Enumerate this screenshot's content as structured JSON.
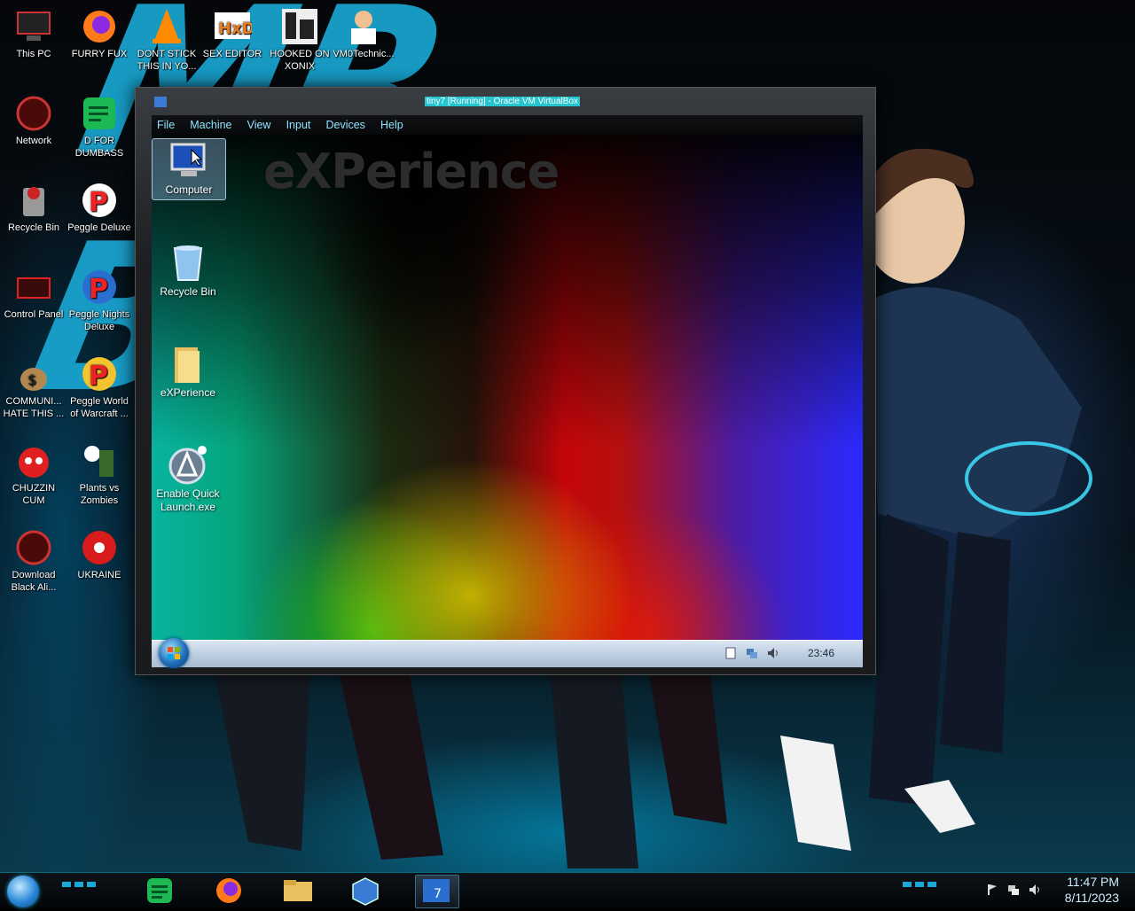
{
  "wallpaper": {
    "headline": "MR BEAST"
  },
  "host_desktop": {
    "icons": [
      {
        "label": "This PC",
        "icon": "computer-icon"
      },
      {
        "label": "FURRY FUX",
        "icon": "firefox-icon"
      },
      {
        "label": "DONT STICK THIS IN YO...",
        "icon": "vlc-cone-icon"
      },
      {
        "label": "SEX EDITOR",
        "icon": "hxd-editor-icon"
      },
      {
        "label": "HOOKED ON XONIX",
        "icon": "xonix-game-icon"
      },
      {
        "label": "VM0Technic...",
        "icon": "technician-icon"
      },
      {
        "label": "Network",
        "icon": "network-icon"
      },
      {
        "label": "D FOR DUMBASS",
        "icon": "document-icon"
      },
      {
        "label": "Recycle Bin",
        "icon": "recycle-bin-icon"
      },
      {
        "label": "Peggle Deluxe",
        "icon": "peggle-icon"
      },
      {
        "label": "Control Panel",
        "icon": "control-panel-icon"
      },
      {
        "label": "Peggle Nights Deluxe",
        "icon": "peggle-nights-icon"
      },
      {
        "label": "COMMUNI... HATE THIS ...",
        "icon": "money-bag-icon"
      },
      {
        "label": "Peggle World of Warcraft ...",
        "icon": "peggle-wow-icon"
      },
      {
        "label": "CHUZZIN CUM",
        "icon": "chuzzle-icon"
      },
      {
        "label": "Plants vs Zombies",
        "icon": "plants-vs-zombies-icon"
      },
      {
        "label": "Download Black Ali...",
        "icon": "download-icon"
      },
      {
        "label": "UKRAINE",
        "icon": "radiation-icon"
      }
    ]
  },
  "vm_window": {
    "title": "tiny7 [Running] - Oracle VM VirtualBox",
    "menu": [
      "File",
      "Machine",
      "View",
      "Input",
      "Devices",
      "Help"
    ],
    "guest": {
      "brand_text": "eXPerience",
      "icons": [
        {
          "label": "Computer",
          "icon": "computer-icon",
          "selected": true
        },
        {
          "label": "Recycle Bin",
          "icon": "recycle-bin-icon",
          "selected": false
        },
        {
          "label": "eXPerience",
          "icon": "folder-icon",
          "selected": false
        },
        {
          "label": "Enable Quick Launch.exe",
          "icon": "quick-launch-icon",
          "selected": false
        }
      ],
      "taskbar": {
        "clock": "23:46"
      }
    }
  },
  "host_taskbar": {
    "pinned": [
      {
        "icon": "notes-app-icon"
      },
      {
        "icon": "firefox-icon"
      },
      {
        "icon": "file-explorer-icon"
      },
      {
        "icon": "virtualbox-icon"
      },
      {
        "icon": "windows7-vm-icon",
        "active": true
      }
    ],
    "clock_time": "11:47 PM",
    "clock_date": "8/11/2023"
  },
  "colors": {
    "accent": "#1aa9d6",
    "vm_title_highlight": "#25c5cf",
    "menu_text": "#8fe3ff"
  }
}
